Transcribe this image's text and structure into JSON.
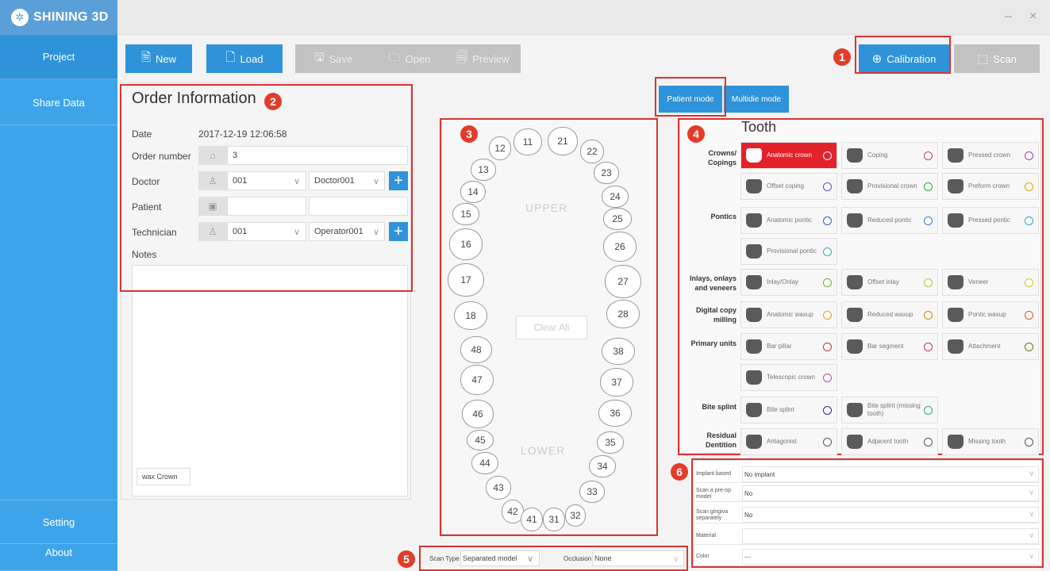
{
  "app": {
    "brand": "SHINING 3D",
    "minimize": "–",
    "close": "×"
  },
  "sidebar": {
    "items": [
      {
        "label": "Project"
      },
      {
        "label": "Share Data"
      },
      {
        "label": "Setting"
      },
      {
        "label": "About"
      }
    ]
  },
  "toolbar": {
    "new": "New",
    "load": "Load",
    "save": "Save",
    "open": "Open",
    "preview": "Preview",
    "calibration": "Calibration",
    "scan": "Scan"
  },
  "modes": {
    "patient": "Patient mode",
    "multidie": "Multidie mode"
  },
  "badges": [
    "1",
    "2",
    "3",
    "4",
    "5",
    "6"
  ],
  "order": {
    "title": "Order Information",
    "date_label": "Date",
    "date_value": "2017-12-19 12:06:58",
    "order_number_label": "Order number",
    "order_number_value": "3",
    "doctor_label": "Doctor",
    "doctor_id": "001",
    "doctor_name": "Doctor001",
    "patient_label": "Patient",
    "patient_value": "",
    "patient_value2": "",
    "technician_label": "Technician",
    "technician_id": "001",
    "technician_name": "Operator001",
    "notes_label": "Notes",
    "notes_value": "",
    "tag_button": "wax Crown"
  },
  "chart": {
    "upper_label": "UPPER",
    "lower_label": "LOWER",
    "clear_all": "Clear All",
    "teeth": [
      "11",
      "12",
      "13",
      "14",
      "15",
      "16",
      "17",
      "18",
      "21",
      "22",
      "23",
      "24",
      "25",
      "26",
      "27",
      "28",
      "31",
      "32",
      "33",
      "34",
      "35",
      "36",
      "37",
      "38",
      "41",
      "42",
      "43",
      "44",
      "45",
      "46",
      "47",
      "48"
    ]
  },
  "tooth_panel": {
    "title": "Tooth",
    "categories": [
      "Crowns/ Copings",
      "Pontics",
      "Inlays, onlays and veneers",
      "Digital copy milling",
      "Primary units",
      "Bite splint",
      "Residual Dentition"
    ],
    "items": [
      {
        "label": "Anatomic crown",
        "color": "#ffffff",
        "selected": true
      },
      {
        "label": "Coping",
        "color": "#d23c5a"
      },
      {
        "label": "Pressed crown",
        "color": "#a03cb4"
      },
      {
        "label": "Offset coping",
        "color": "#5a50c8"
      },
      {
        "label": "Provisional crown",
        "color": "#2ea83c"
      },
      {
        "label": "Preform crown",
        "color": "#d8a400"
      },
      {
        "label": "Anatomic pontic",
        "color": "#3c5ad2"
      },
      {
        "label": "Reduced pontic",
        "color": "#3c78d2"
      },
      {
        "label": "Pressed pontic",
        "color": "#2ea0d2"
      },
      {
        "label": "Provisional pontic",
        "color": "#2ab4a0"
      },
      {
        "label": "Inlay/Onlay",
        "color": "#64b432"
      },
      {
        "label": "Offset inlay",
        "color": "#a0c828"
      },
      {
        "label": "Veneer",
        "color": "#c8c828"
      },
      {
        "label": "Anatomic waxup",
        "color": "#e6a014"
      },
      {
        "label": "Reduced waxup",
        "color": "#e67814"
      },
      {
        "label": "Pontic waxup",
        "color": "#d25a1e"
      },
      {
        "label": "Bar pillar",
        "color": "#c8283c"
      },
      {
        "label": "Bar segment",
        "color": "#c82878"
      },
      {
        "label": "Attachment",
        "color": "#6e6e1e"
      },
      {
        "label": "Telescopic crown",
        "color": "#c83cb4"
      },
      {
        "label": "Bite splint",
        "color": "#282896"
      },
      {
        "label": "Bite splint (missing tooth)",
        "color": "#28a08c"
      },
      {
        "label": "Antagonist",
        "color": "#555555"
      },
      {
        "label": "Adjacent tooth",
        "color": "#555555"
      },
      {
        "label": "Missing tooth",
        "color": "#555555"
      }
    ]
  },
  "options": {
    "implant_label": "Implant based",
    "implant_value": "No implant",
    "preop_label": "Scan a pre-op model",
    "preop_value": "No",
    "gingiva_label": "Scan gingiva separately",
    "gingiva_value": "No",
    "material_label": "Material",
    "material_value": "",
    "color_label": "Color",
    "color_value": "---"
  },
  "scan": {
    "type_label": "Scan Type",
    "type_value": "Separated model",
    "occlusion_label": "Occlusion",
    "occlusion_value": "None"
  }
}
